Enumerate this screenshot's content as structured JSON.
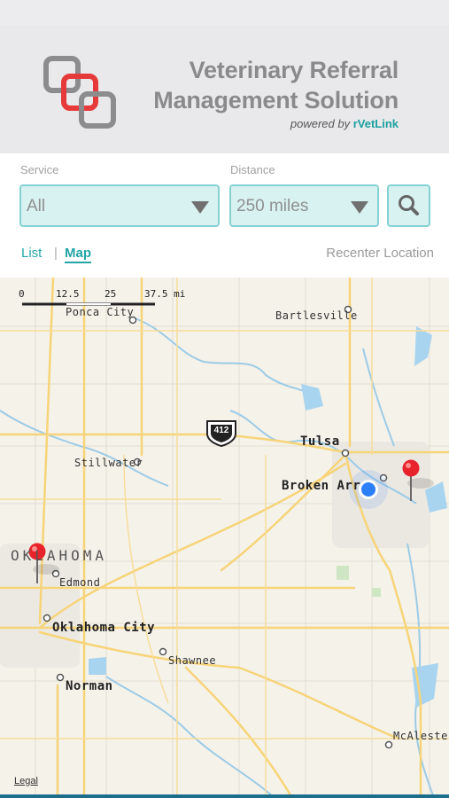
{
  "header": {
    "title_line1": "Veterinary Referral",
    "title_line2": "Management Solution",
    "powered_prefix": "powered by ",
    "powered_brand": "rVetLink"
  },
  "filters": {
    "service_label": "Service",
    "service_value": "All",
    "distance_label": "Distance",
    "distance_value": "250 miles"
  },
  "views": {
    "list_label": "List",
    "separator": "|",
    "map_label": "Map",
    "recenter_label": "Recenter Location"
  },
  "map": {
    "scale_labels": [
      "0",
      "12.5",
      "25",
      "37.5 mi"
    ],
    "cities": {
      "ponca_city": "Ponca City",
      "bartlesville": "Bartlesville",
      "stillwater": "Stillwater",
      "tulsa": "Tulsa",
      "broken_arrow": "Broken Arr",
      "edmond": "Edmond",
      "oklahoma_city": "Oklahoma City",
      "shawnee": "Shawnee",
      "norman": "Norman",
      "mcalester": "McAlester"
    },
    "state_label": "OKLAHOMA",
    "highway_shield": "412",
    "legal_label": "Legal"
  },
  "colors": {
    "accent": "#22a5a5",
    "field_bg": "#d8f1f1",
    "field_border": "#86d2d3",
    "pin": "#e8232b",
    "location_dot": "#2d7ff9"
  }
}
